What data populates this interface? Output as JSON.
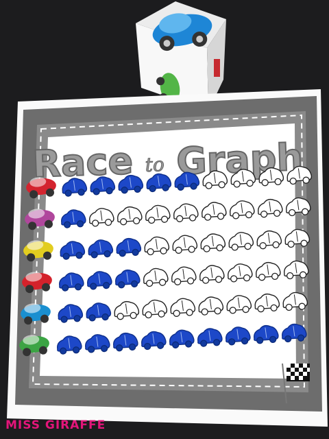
{
  "title": {
    "word1": "Race",
    "word2": "to",
    "word3": "Graph"
  },
  "credit": "MISS GIRAFFE",
  "colors": {
    "background": "#1c1c1e",
    "board_gray": "#6d6d6d",
    "board_paper": "#ffffff",
    "dot_marker": "#1d48c8",
    "car_colors": [
      "#d3242f",
      "#b0479c",
      "#e2cd1f",
      "#d4222b",
      "#1a8fd0",
      "#3ca444"
    ],
    "die_car_top": "#1e86d6",
    "die_car_side": "#53b547"
  },
  "graph": {
    "rows": [
      {
        "car": "red",
        "filled": 5,
        "total": 9
      },
      {
        "car": "purple",
        "filled": 1,
        "total": 9
      },
      {
        "car": "yellow",
        "filled": 3,
        "total": 9
      },
      {
        "car": "red",
        "filled": 3,
        "total": 9
      },
      {
        "car": "blue",
        "filled": 2,
        "total": 9
      },
      {
        "car": "green",
        "filled": 9,
        "total": 9
      }
    ]
  }
}
